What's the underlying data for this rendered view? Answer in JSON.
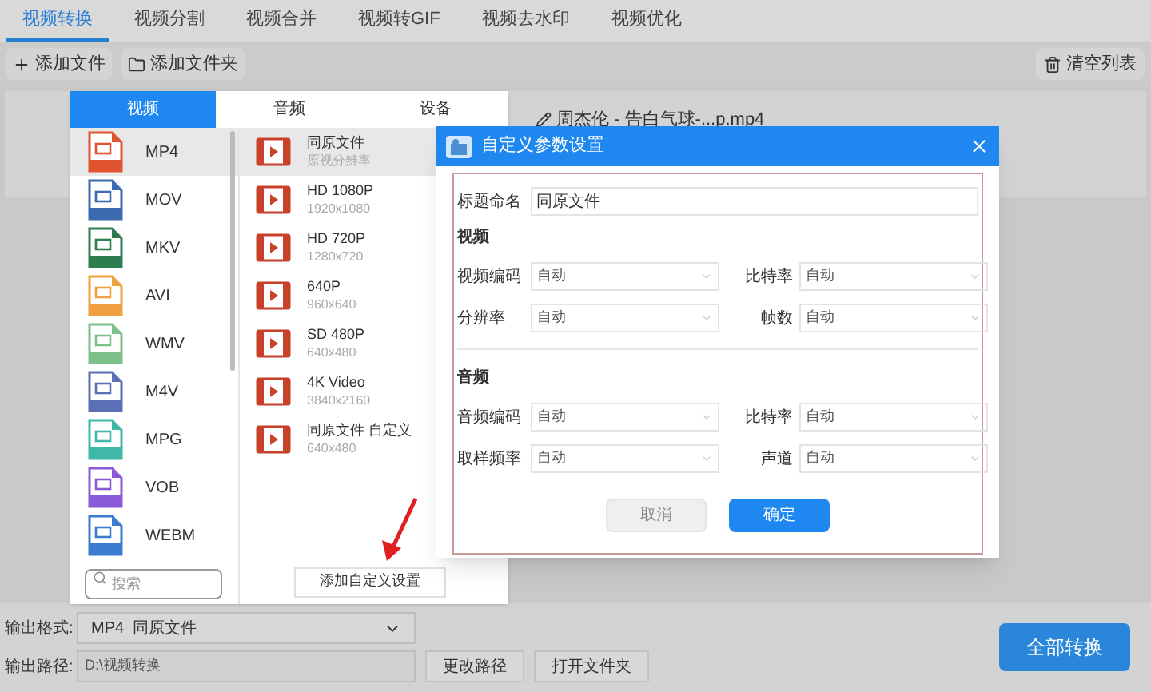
{
  "tabs": [
    {
      "label": "视频转换",
      "selected": true
    },
    {
      "label": "视频分割",
      "selected": false
    },
    {
      "label": "视频合并",
      "selected": false
    },
    {
      "label": "视频转GIF",
      "selected": false
    },
    {
      "label": "视频去水印",
      "selected": false
    },
    {
      "label": "视频优化",
      "selected": false
    }
  ],
  "toolbar": {
    "buttons": [
      {
        "label": "添加文件",
        "kind": "add"
      },
      {
        "label": "添加文件夹",
        "kind": "folder"
      }
    ],
    "clear": "清空列表"
  },
  "file": {
    "name": "周杰伦 - 告白气球-...p.mp4"
  },
  "format_popup": {
    "tabs": [
      {
        "label": "视频",
        "selected": true
      },
      {
        "label": "音频",
        "selected": false
      },
      {
        "label": "设备",
        "selected": false
      }
    ],
    "formats": [
      {
        "label": "MP4",
        "color": "#e0552f",
        "selected": true
      },
      {
        "label": "MOV",
        "color": "#3a6ab0",
        "selected": false
      },
      {
        "label": "MKV",
        "color": "#2e7d4f",
        "selected": false
      },
      {
        "label": "AVI",
        "color": "#f0a040",
        "selected": false
      },
      {
        "label": "WMV",
        "color": "#7cc08a",
        "selected": false
      },
      {
        "label": "M4V",
        "color": "#5a6fb5",
        "selected": false
      },
      {
        "label": "MPG",
        "color": "#3fb8a8",
        "selected": false
      },
      {
        "label": "VOB",
        "color": "#8a5ad8",
        "selected": false
      },
      {
        "label": "WEBM",
        "color": "#3a7cd0",
        "selected": false
      }
    ],
    "presets": [
      {
        "name": "同原文件",
        "detail": "原视分辨率",
        "selected": true
      },
      {
        "name": "HD 1080P",
        "detail": "1920x1080",
        "selected": false
      },
      {
        "name": "HD 720P",
        "detail": "1280x720",
        "selected": false
      },
      {
        "name": "640P",
        "detail": "960x640",
        "selected": false
      },
      {
        "name": "SD 480P",
        "detail": "640x480",
        "selected": false
      },
      {
        "name": "4K Video",
        "detail": "3840x2160",
        "selected": false
      },
      {
        "name": "同原文件 自定义",
        "detail": "640x480",
        "selected": false
      }
    ],
    "search_placeholder": "搜索",
    "add_button": "添加自定义设置"
  },
  "dialog": {
    "title": "自定义参数设置",
    "title_label": "标题命名",
    "title_value": "同原文件",
    "sections": [
      {
        "heading": "视频",
        "fields": [
          {
            "label": "视频编码",
            "value": "自动"
          },
          {
            "label": "比特率",
            "value": "自动"
          },
          {
            "label": "分辨率",
            "value": "自动"
          },
          {
            "label": "帧数",
            "value": "自动"
          }
        ]
      },
      {
        "heading": "音频",
        "fields": [
          {
            "label": "音频编码",
            "value": "自动"
          },
          {
            "label": "比特率",
            "value": "自动"
          },
          {
            "label": "取样频率",
            "value": "自动"
          },
          {
            "label": "声道",
            "value": "自动"
          }
        ]
      }
    ],
    "cancel": "取消",
    "confirm": "确定"
  },
  "output": {
    "format_label": "输出格式:",
    "format_value": "MP4  同原文件",
    "path_label": "输出路径:",
    "path_value": "D:\\视频转换",
    "buttons": [
      "更改路径",
      "打开文件夹"
    ],
    "convert": "全部转换"
  }
}
